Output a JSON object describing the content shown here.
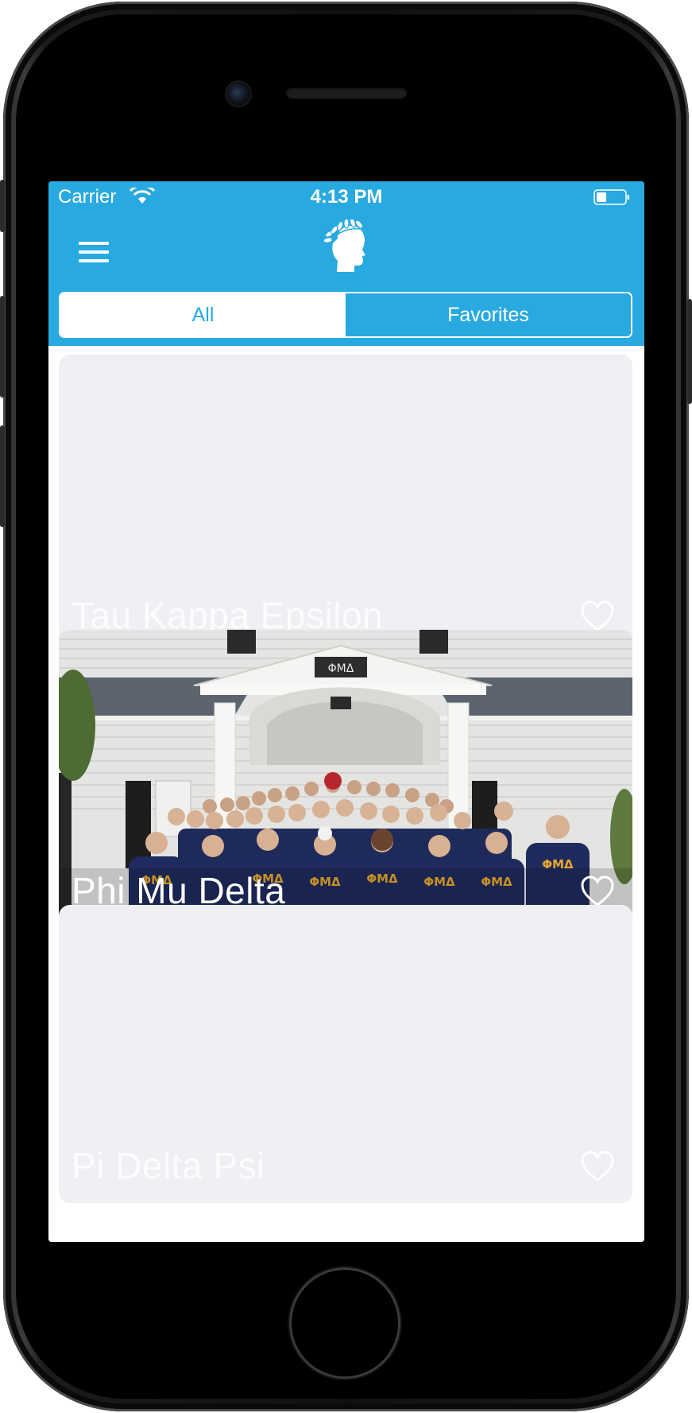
{
  "status_bar": {
    "carrier": "Carrier",
    "time": "4:13 PM"
  },
  "header": {
    "logo_icon": "laurel-head-icon",
    "menu_icon": "hamburger-menu-icon"
  },
  "tabs": [
    {
      "label": "All",
      "selected": true
    },
    {
      "label": "Favorites",
      "selected": false
    }
  ],
  "cards": [
    {
      "name": "Tau Kappa Epsilon",
      "favorited": false,
      "image_loaded": false
    },
    {
      "name": "Phi Mu Delta",
      "favorited": false,
      "image_loaded": true,
      "house_sign": "ΦΜΔ"
    },
    {
      "name": "Pi Delta Psi",
      "favorited": false,
      "image_loaded": false
    }
  ],
  "colors": {
    "accent": "#28a9e0",
    "card_placeholder": "#efeff4",
    "shirt_navy": "#1e2a5a",
    "shirt_letters": "#e8a82a"
  }
}
